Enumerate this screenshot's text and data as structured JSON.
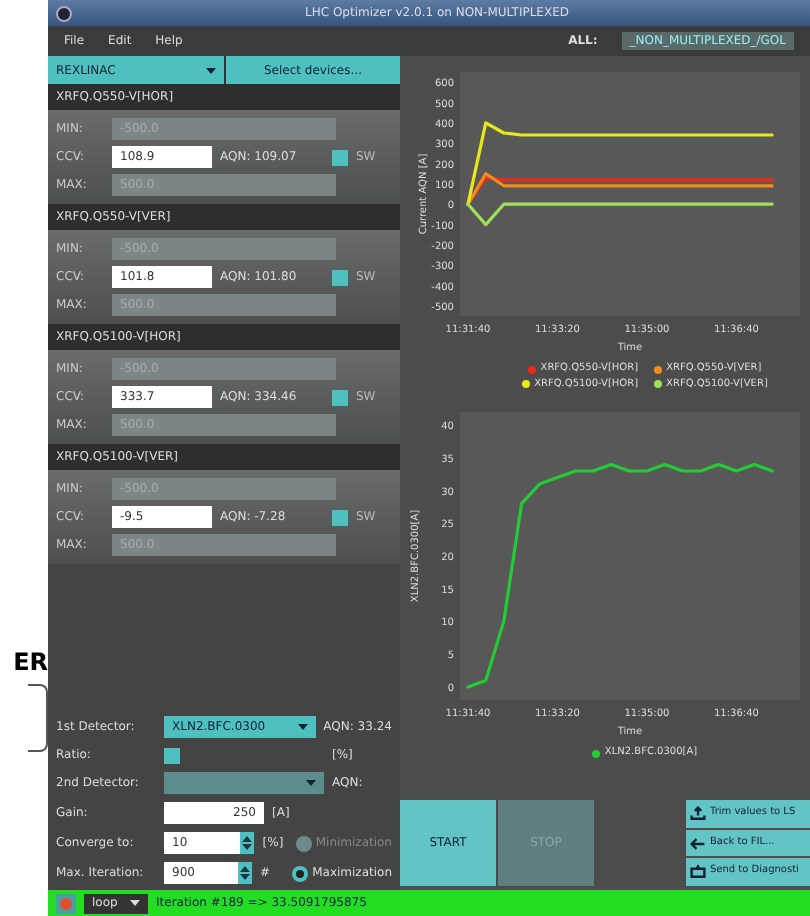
{
  "backdrop": {
    "text": "ER"
  },
  "window": {
    "title": "LHC Optimizer v2.0.1 on NON-MULTIPLEXED"
  },
  "menu": [
    "File",
    "Edit",
    "Help"
  ],
  "context": {
    "label": "ALL:",
    "value": "_NON_MULTIPLEXED_/GOL"
  },
  "accelerator": {
    "value": "REXLINAC",
    "button": "Select devices..."
  },
  "devices": [
    {
      "name": "XRFQ.Q550-V[HOR]",
      "min_label": "MIN:",
      "min": "-500.0",
      "ccv_label": "CCV:",
      "ccv": "108.9",
      "aqn": "AQN: 109.07",
      "sw": "SW",
      "checked": false,
      "max_label": "MAX:",
      "max": "500.0"
    },
    {
      "name": "XRFQ.Q550-V[VER]",
      "min_label": "MIN:",
      "min": "-500.0",
      "ccv_label": "CCV:",
      "ccv": "101.8",
      "aqn": "AQN: 101.80",
      "sw": "SW",
      "checked": false,
      "max_label": "MAX:",
      "max": "500.0"
    },
    {
      "name": "XRFQ.Q5100-V[HOR]",
      "min_label": "MIN:",
      "min": "-500.0",
      "ccv_label": "CCV:",
      "ccv": "333.7",
      "aqn": "AQN: 334.46",
      "sw": "SW",
      "checked": false,
      "max_label": "MAX:",
      "max": "500.0"
    },
    {
      "name": "XRFQ.Q5100-V[VER]",
      "min_label": "MIN:",
      "min": "-500.0",
      "ccv_label": "CCV:",
      "ccv": "-9.5",
      "aqn": "AQN: -7.28",
      "sw": "SW",
      "checked": false,
      "max_label": "MAX:",
      "max": "500.0"
    }
  ],
  "charts": [
    {
      "chart_data": {
        "type": "line",
        "xlabel": "Time",
        "ylabel": "Current AQN [A]",
        "categories": [
          "11:31:40",
          null,
          null,
          null,
          null,
          "11:33:20",
          null,
          null,
          null,
          null,
          "11:35:00",
          null,
          null,
          null,
          null,
          "11:36:40",
          null,
          null
        ],
        "series": [
          {
            "name": "XRFQ.Q550-V[HOR]",
            "color": "#ee2a1a",
            "values": [
              0,
              130,
              120,
              120,
              120,
              120,
              120,
              120,
              120,
              120,
              120,
              120,
              120,
              120,
              120,
              120,
              120,
              120
            ]
          },
          {
            "name": "XRFQ.Q550-V[VER]",
            "color": "#f08a1a",
            "values": [
              0,
              150,
              90,
              90,
              90,
              90,
              90,
              90,
              90,
              90,
              90,
              90,
              90,
              90,
              90,
              90,
              90,
              90
            ]
          },
          {
            "name": "XRFQ.Q5100-V[HOR]",
            "color": "#e8e81a",
            "values": [
              0,
              400,
              350,
              340,
              340,
              340,
              340,
              340,
              340,
              340,
              340,
              340,
              340,
              340,
              340,
              340,
              340,
              340
            ]
          },
          {
            "name": "XRFQ.Q5100-V[VER]",
            "color": "#9ee05a",
            "values": [
              0,
              -100,
              0,
              0,
              0,
              0,
              0,
              0,
              0,
              0,
              0,
              0,
              0,
              0,
              0,
              0,
              0,
              0
            ]
          }
        ],
        "ylim": [
          -550,
          650
        ],
        "legend": true,
        "yticks": [
          -500,
          -400,
          -300,
          -200,
          -100,
          0,
          100,
          200,
          300,
          400,
          500,
          600
        ]
      }
    },
    {
      "chart_data": {
        "type": "line",
        "xlabel": "Time",
        "ylabel": "XLN2.BFC.0300[A]",
        "categories": [
          "11:31:40",
          null,
          null,
          null,
          null,
          "11:33:20",
          null,
          null,
          null,
          null,
          "11:35:00",
          null,
          null,
          null,
          null,
          "11:36:40",
          null,
          null
        ],
        "series": [
          {
            "name": "XLN2.BFC.0300[A]",
            "color": "#22cc33",
            "values": [
              0,
              1,
              10,
              28,
              31,
              32,
              33,
              33,
              34,
              33,
              33,
              34,
              33,
              33,
              34,
              33,
              34,
              33
            ]
          }
        ],
        "ylim": [
          -2,
          42
        ],
        "legend": true,
        "yticks": [
          0,
          5,
          10,
          15,
          20,
          25,
          30,
          35,
          40
        ]
      }
    }
  ],
  "form": {
    "det1_label": "1st Detector:",
    "det1": "XLN2.BFC.0300",
    "det1_aqn": "AQN: 33.24",
    "ratio_label": "Ratio:",
    "ratio_checked": false,
    "ratio_unit": "[%]",
    "det2_label": "2nd Detector:",
    "det2_aqn": "AQN:",
    "gain_label": "Gain:",
    "gain": "250",
    "gain_unit": "[A]",
    "conv_label": "Converge to:",
    "conv": "10",
    "conv_unit": "[%]",
    "iter_label": "Max. Iteration:",
    "iter": "900",
    "iter_unit": "#",
    "modes": [
      {
        "label": "Minimization",
        "selected": false,
        "disabled": true
      },
      {
        "label": "Maximization",
        "selected": true,
        "disabled": false
      }
    ]
  },
  "actions": [
    {
      "label": "START",
      "disabled": false
    },
    {
      "label": "STOP",
      "disabled": true
    }
  ],
  "side_buttons": [
    {
      "label": "Trim values to LS",
      "kind": "upload"
    },
    {
      "label": "Back to FIL...",
      "kind": "back"
    },
    {
      "label": "Send to Diagnosti",
      "kind": "camera"
    }
  ],
  "status": {
    "mode": "loop",
    "message": "Iteration #189 => 33.5091795875"
  }
}
